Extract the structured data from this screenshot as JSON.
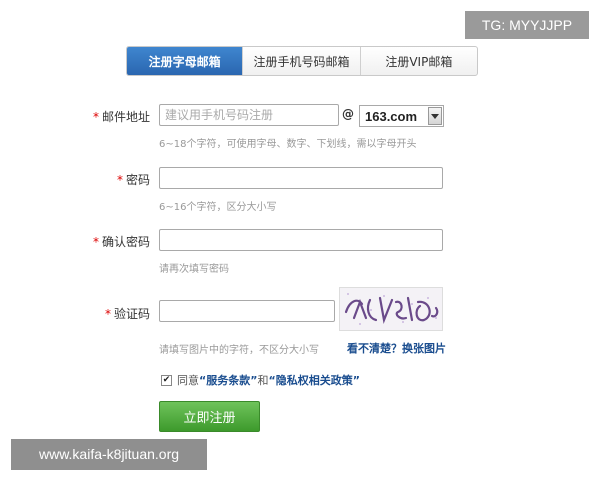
{
  "overlay": {
    "tg_badge": "TG: MYYJJPP",
    "watermark": "www.kaifa-k8jituan.org"
  },
  "tabs": [
    {
      "label": "注册字母邮箱",
      "active": true
    },
    {
      "label": "注册手机号码邮箱",
      "active": false
    },
    {
      "label": "注册VIP邮箱",
      "active": false
    }
  ],
  "form": {
    "required_mark": "*",
    "email": {
      "label": "邮件地址",
      "placeholder": "建议用手机号码注册",
      "value": "",
      "at": "@",
      "domain_selected": "163.com",
      "hint": "6~18个字符，可使用字母、数字、下划线，需以字母开头"
    },
    "password": {
      "label": "密码",
      "value": "",
      "hint": "6~16个字符，区分大小写"
    },
    "confirm_password": {
      "label": "确认密码",
      "value": "",
      "hint": "请再次填写密码"
    },
    "captcha": {
      "label": "验证码",
      "value": "",
      "hint": "请填写图片中的字符，不区分大小写",
      "refresh_link": "看不清楚？换张图片"
    },
    "agree": {
      "checked": true,
      "prefix": "同意",
      "terms": "“服务条款”",
      "and": "和",
      "privacy": "“隐私权相关政策”"
    },
    "submit_label": "立即注册"
  },
  "colors": {
    "active_tab": "#2f6fbf",
    "submit_green": "#4caf3a",
    "required_red": "#dd0000",
    "link_blue": "#1a4d8f"
  }
}
